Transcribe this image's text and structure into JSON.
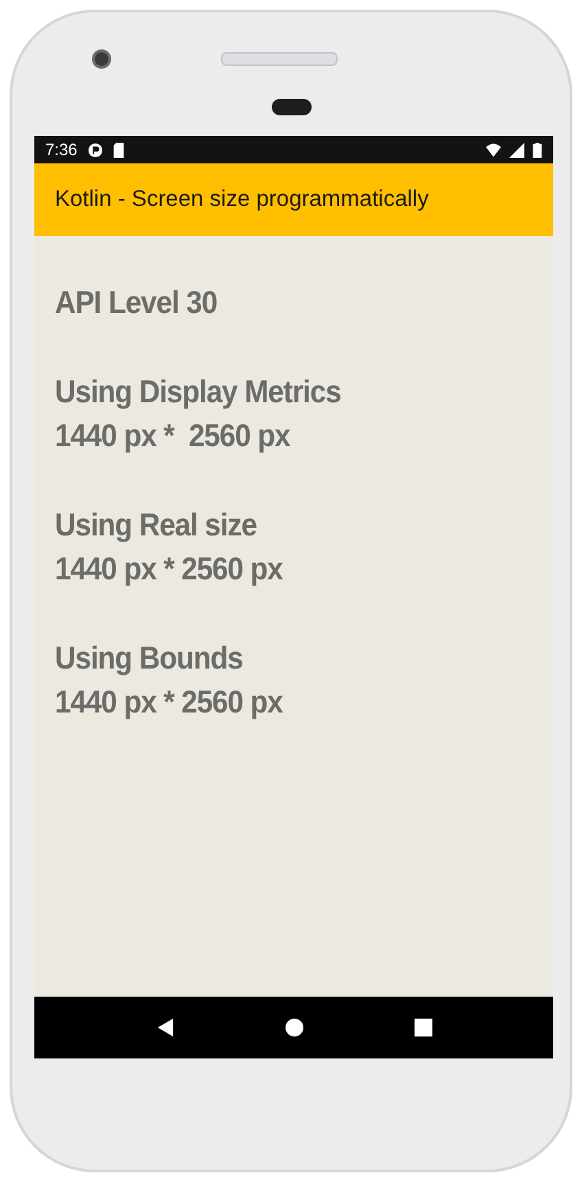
{
  "status_bar": {
    "time": "7:36"
  },
  "app_bar": {
    "title": "Kotlin - Screen size programmatically"
  },
  "sections": [
    {
      "heading": "API Level 30"
    },
    {
      "heading": "Using Display Metrics",
      "value": "1440 px *  2560 px"
    },
    {
      "heading": "Using Real size",
      "value": "1440 px * 2560 px"
    },
    {
      "heading": "Using Bounds",
      "value": "1440 px * 2560 px"
    }
  ]
}
